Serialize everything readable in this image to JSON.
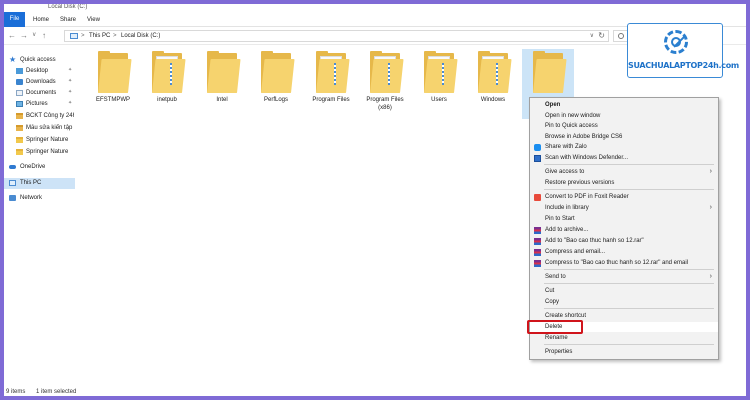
{
  "window": {
    "title": "Local Disk (C:)"
  },
  "ribbon": {
    "tabs": [
      "File",
      "Home",
      "Share",
      "View"
    ]
  },
  "address": {
    "crumbs": [
      "This PC",
      "Local Disk (C:)"
    ],
    "separator": ">"
  },
  "sidebar": {
    "items": [
      {
        "label": "Quick access",
        "icon": "star-icon",
        "pinned": false
      },
      {
        "label": "Desktop",
        "icon": "desktop-icon",
        "pinned": true
      },
      {
        "label": "Downloads",
        "icon": "downloads-icon",
        "pinned": true
      },
      {
        "label": "Documents",
        "icon": "documents-icon",
        "pinned": true
      },
      {
        "label": "Pictures",
        "icon": "pictures-icon",
        "pinned": true
      },
      {
        "label": "BCKT Công ty 24h C",
        "icon": "folder-icon",
        "pinned": false
      },
      {
        "label": "Mẫu sửa kiến tập 24",
        "icon": "folder-icon",
        "pinned": false
      },
      {
        "label": "Springer Nature",
        "icon": "folder-icon",
        "pinned": false
      },
      {
        "label": "Springer Nature",
        "icon": "folder-icon",
        "pinned": false
      },
      {
        "label": "OneDrive",
        "icon": "onedrive-icon",
        "pinned": false
      },
      {
        "label": "This PC",
        "icon": "this-pc-icon",
        "pinned": false,
        "selected": true
      },
      {
        "label": "Network",
        "icon": "network-icon",
        "pinned": false
      }
    ]
  },
  "folders": [
    {
      "label": "EFSTMPWP",
      "type": "plain"
    },
    {
      "label": "inetpub",
      "type": "files"
    },
    {
      "label": "Intel",
      "type": "plain"
    },
    {
      "label": "PerfLogs",
      "type": "plain"
    },
    {
      "label": "Program Files",
      "type": "files"
    },
    {
      "label": "Program Files (x86)",
      "type": "files"
    },
    {
      "label": "Users",
      "type": "files"
    },
    {
      "label": "Windows",
      "type": "files"
    },
    {
      "label": "",
      "type": "plain",
      "selected": true
    }
  ],
  "context_menu": {
    "items": [
      {
        "label": "Open",
        "bold": true
      },
      {
        "label": "Open in new window"
      },
      {
        "label": "Pin to Quick access"
      },
      {
        "label": "Browse in Adobe Bridge CS6"
      },
      {
        "label": "Share with Zalo",
        "icon": "zalo-icon"
      },
      {
        "label": "Scan with Windows Defender...",
        "icon": "windows-defender-icon"
      },
      {
        "label": "Give access to",
        "submenu": true
      },
      {
        "label": "Restore previous versions"
      },
      {
        "label": "Convert to PDF in Foxit Reader",
        "icon": "pdf-icon"
      },
      {
        "label": "Include in library",
        "submenu": true
      },
      {
        "label": "Pin to Start"
      },
      {
        "label": "Add to archive...",
        "icon": "winrar-icon"
      },
      {
        "label": "Add to \"Bao cao thuc hanh so 12.rar\"",
        "icon": "winrar-icon"
      },
      {
        "label": "Compress and email...",
        "icon": "winrar-icon"
      },
      {
        "label": "Compress to \"Bao cao thuc hanh so 12.rar\" and email",
        "icon": "winrar-icon"
      },
      {
        "label": "Send to",
        "submenu": true
      },
      {
        "label": "Cut"
      },
      {
        "label": "Copy"
      },
      {
        "label": "Create shortcut"
      },
      {
        "label": "Delete",
        "highlighted": true
      },
      {
        "label": "Rename"
      },
      {
        "label": "Properties"
      }
    ]
  },
  "status": {
    "items_count": "9 items",
    "selected": "1 item selected"
  },
  "logo": {
    "text": "SUACHUALAPTOP24h.com"
  },
  "colors": {
    "accent": "#1a6ed8",
    "highlight_box": "#d0141b",
    "frame": "#7f6bd6"
  }
}
